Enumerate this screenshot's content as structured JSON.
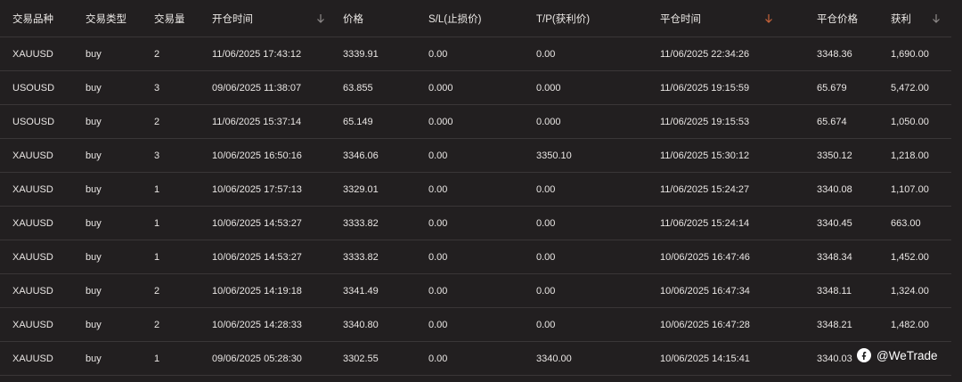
{
  "columns": [
    "交易品种",
    "交易类型",
    "交易量",
    "开仓时间",
    "价格",
    "S/L(止损价)",
    "T/P(获利价)",
    "平仓时间",
    "平仓价格",
    "获利"
  ],
  "sort_colors": {
    "default": "#8e8a89",
    "active": "#c9643a"
  },
  "rows": [
    [
      "XAUUSD",
      "buy",
      "2",
      "11/06/2025 17:43:12",
      "3339.91",
      "0.00",
      "0.00",
      "11/06/2025 22:34:26",
      "3348.36",
      "1,690.00"
    ],
    [
      "USOUSD",
      "buy",
      "3",
      "09/06/2025 11:38:07",
      "63.855",
      "0.000",
      "0.000",
      "11/06/2025 19:15:59",
      "65.679",
      "5,472.00"
    ],
    [
      "USOUSD",
      "buy",
      "2",
      "11/06/2025 15:37:14",
      "65.149",
      "0.000",
      "0.000",
      "11/06/2025 19:15:53",
      "65.674",
      "1,050.00"
    ],
    [
      "XAUUSD",
      "buy",
      "3",
      "10/06/2025 16:50:16",
      "3346.06",
      "0.00",
      "3350.10",
      "11/06/2025 15:30:12",
      "3350.12",
      "1,218.00"
    ],
    [
      "XAUUSD",
      "buy",
      "1",
      "10/06/2025 17:57:13",
      "3329.01",
      "0.00",
      "0.00",
      "11/06/2025 15:24:27",
      "3340.08",
      "1,107.00"
    ],
    [
      "XAUUSD",
      "buy",
      "1",
      "10/06/2025 14:53:27",
      "3333.82",
      "0.00",
      "0.00",
      "11/06/2025 15:24:14",
      "3340.45",
      "663.00"
    ],
    [
      "XAUUSD",
      "buy",
      "1",
      "10/06/2025 14:53:27",
      "3333.82",
      "0.00",
      "0.00",
      "10/06/2025 16:47:46",
      "3348.34",
      "1,452.00"
    ],
    [
      "XAUUSD",
      "buy",
      "2",
      "10/06/2025 14:19:18",
      "3341.49",
      "0.00",
      "0.00",
      "10/06/2025 16:47:34",
      "3348.11",
      "1,324.00"
    ],
    [
      "XAUUSD",
      "buy",
      "2",
      "10/06/2025 14:28:33",
      "3340.80",
      "0.00",
      "0.00",
      "10/06/2025 16:47:28",
      "3348.21",
      "1,482.00"
    ],
    [
      "XAUUSD",
      "buy",
      "1",
      "09/06/2025 05:28:30",
      "3302.55",
      "0.00",
      "3340.00",
      "10/06/2025 14:15:41",
      "3340.03",
      ""
    ]
  ],
  "watermark": {
    "icon": "wechat-channel-icon",
    "text": "@WeTrade"
  }
}
